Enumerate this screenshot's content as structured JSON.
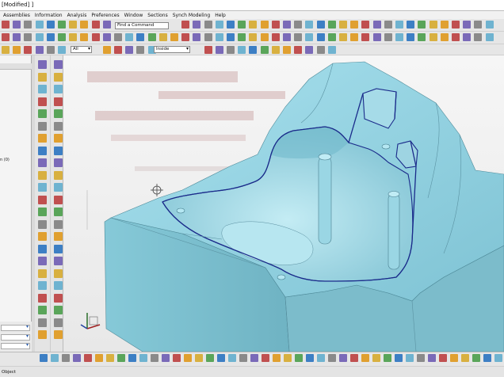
{
  "window": {
    "title": "[Modified] ]"
  },
  "menu": {
    "items": [
      "Assemblies",
      "Information",
      "Analysis",
      "Preferences",
      "Window",
      "Sections",
      "Synch Modeling",
      "Help"
    ]
  },
  "toolbar": {
    "find_command_label": "Find a Command",
    "filter_value": "All",
    "snap_value": "Inside"
  },
  "left_panel": {
    "visible_text": "n (0)"
  },
  "status": {
    "text": "Object"
  },
  "colors": {
    "model_face": "#8fd1e0",
    "model_shadow": "#6ea9b8",
    "edge_highlight": "#1a2a8a",
    "background_ghost": "#c8a0a0"
  }
}
